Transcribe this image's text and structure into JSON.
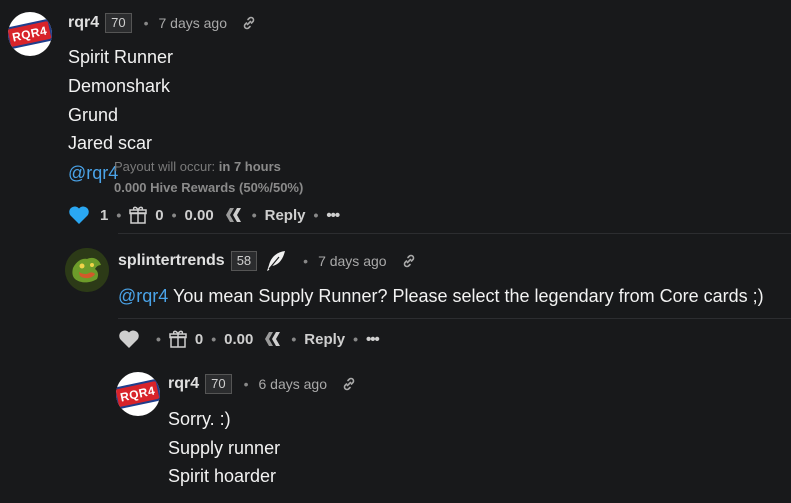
{
  "comments": [
    {
      "user": "rqr4",
      "rep": "70",
      "time": "7 days ago",
      "avatar_text": "RQR4",
      "lines": [
        "Spirit Runner",
        "Demonshark",
        "Grund",
        "Jared scar"
      ],
      "mention": "@rqr4",
      "tooltip": {
        "line1_label": "Payout will occur:",
        "line1_value": "in 7 hours",
        "line2": "0.000 Hive Rewards (50%/50%)"
      },
      "votes": "1",
      "gifts": "0",
      "payout": "0.00",
      "reply": "Reply",
      "more": "•••"
    },
    {
      "user": "splintertrends",
      "rep": "58",
      "time": "7 days ago",
      "mention": "@rqr4",
      "text": " You mean Supply Runner? Please select the legendary from Core cards ;)",
      "gifts": "0",
      "payout": "0.00",
      "reply": "Reply",
      "more": "•••"
    },
    {
      "user": "rqr4",
      "rep": "70",
      "time": "6 days ago",
      "avatar_text": "RQR4",
      "lines": [
        "Sorry. :)",
        "Supply runner",
        "Spirit hoarder"
      ]
    }
  ],
  "colors": {
    "background": "#18191b",
    "heart_active": "#2aa7f2",
    "mention": "#4aa3e8"
  },
  "icons": [
    "link-icon",
    "heart-icon",
    "gift-icon",
    "hive-icon",
    "feather-icon"
  ]
}
